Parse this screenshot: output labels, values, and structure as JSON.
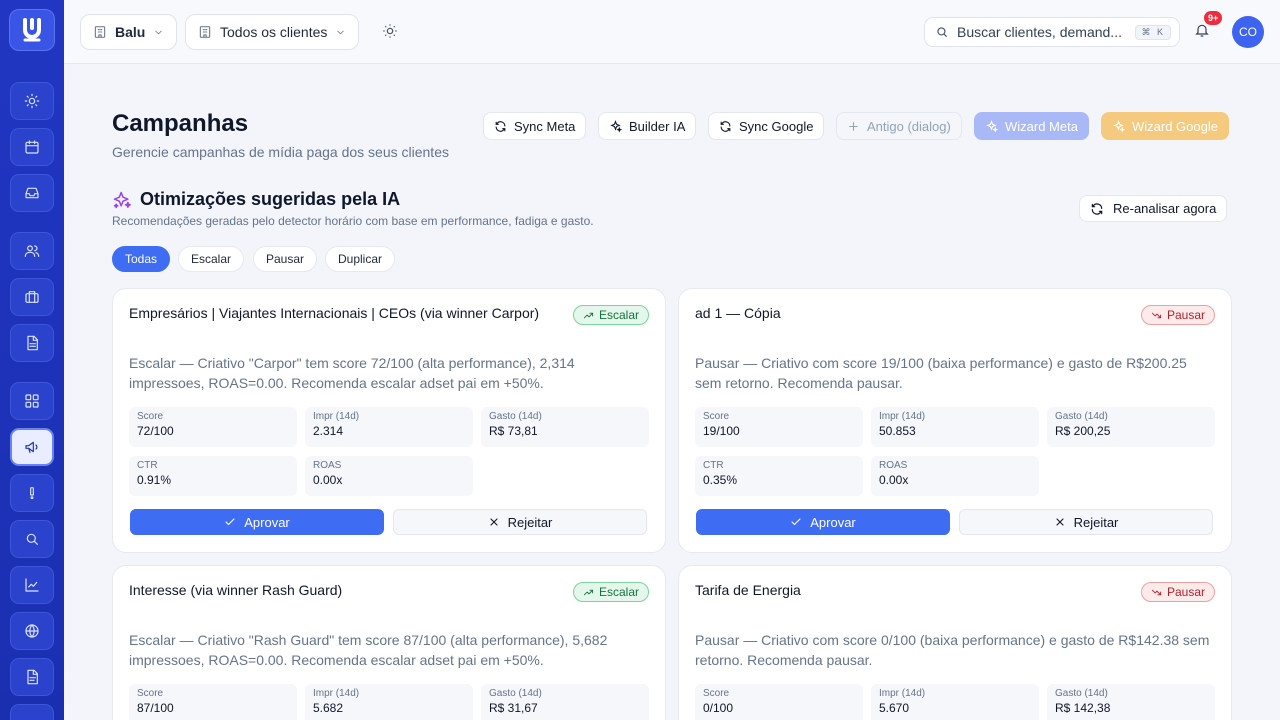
{
  "topbar": {
    "workspace": "Balu",
    "client_filter": "Todos os clientes",
    "search_placeholder": "Buscar clientes, demand...",
    "search_shortcut": "⌘ K",
    "notifications_badge": "9+",
    "avatar_initials": "CO"
  },
  "page": {
    "title": "Campanhas",
    "subtitle": "Gerencie campanhas de mídia paga dos seus clientes",
    "actions": {
      "sync_meta": "Sync Meta",
      "builder_ia": "Builder IA",
      "sync_google": "Sync Google",
      "antigo": "Antigo (dialog)",
      "wizard_meta": "Wizard Meta",
      "wizard_google": "Wizard Google"
    }
  },
  "optim": {
    "title": "Otimizações sugeridas pela IA",
    "subtitle": "Recomendações geradas pelo detector horário com base em performance, fadiga e gasto.",
    "reanalyze": "Re-analisar agora",
    "filters": [
      "Todas",
      "Escalar",
      "Pausar",
      "Duplicar"
    ]
  },
  "labels": {
    "score": "Score",
    "impr": "Impr (14d)",
    "gasto": "Gasto (14d)",
    "ctr": "CTR",
    "roas": "ROAS",
    "approve": "Aprovar",
    "reject": "Rejeitar"
  },
  "cards": [
    {
      "title": "Empresários | Viajantes Internacionais | CEOs (via winner Carpor)",
      "tag": "Escalar",
      "desc": "Escalar — Criativo \"Carpor\" tem score 72/100 (alta performance), 2,314 impressoes, ROAS=0.00. Recomenda escalar adset pai em +50%.",
      "score": "72/100",
      "impr": "2.314",
      "gasto": "R$ 73,81",
      "ctr": "0.91%",
      "roas": "0.00x"
    },
    {
      "title": "ad 1 — Cópia",
      "tag": "Pausar",
      "desc": "Pausar — Criativo com score 19/100 (baixa performance) e gasto de R$200.25 sem retorno. Recomenda pausar.",
      "score": "19/100",
      "impr": "50.853",
      "gasto": "R$ 200,25",
      "ctr": "0.35%",
      "roas": "0.00x"
    },
    {
      "title": "Interesse (via winner Rash Guard)",
      "tag": "Escalar",
      "desc": "Escalar — Criativo \"Rash Guard\" tem score 87/100 (alta performance), 5,682 impressoes, ROAS=0.00. Recomenda escalar adset pai em +50%.",
      "score": "87/100",
      "impr": "5.682",
      "gasto": "R$ 31,67"
    },
    {
      "title": "Tarifa de Energia",
      "tag": "Pausar",
      "desc": "Pausar — Criativo com score 0/100 (baixa performance) e gasto de R$142.38 sem retorno. Recomenda pausar.",
      "score": "0/100",
      "impr": "5.670",
      "gasto": "R$ 142,38"
    }
  ],
  "colors": {
    "sidebar": "#1f33ba",
    "accent": "#3e6cf2",
    "escalar": "#14753a",
    "pausar": "#b4232c"
  }
}
